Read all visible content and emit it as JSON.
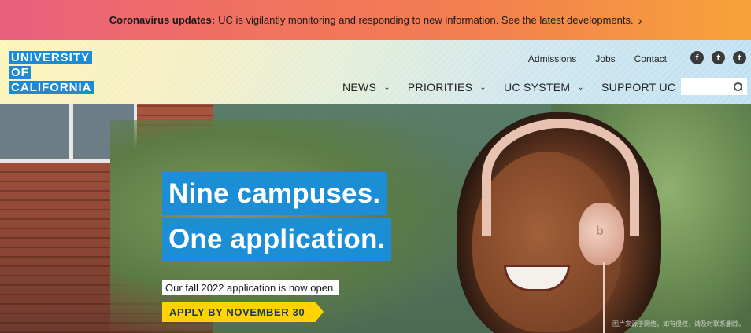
{
  "alert": {
    "label": "Coronavirus updates:",
    "message": "UC is vigilantly monitoring and responding to new information. See the latest developments.",
    "chevron": "›"
  },
  "logo": {
    "line1": "UNIVERSITY",
    "line2": "OF",
    "line3": "CALIFORNIA"
  },
  "utility_links": [
    "Admissions",
    "Jobs",
    "Contact"
  ],
  "social": [
    {
      "icon": "facebook-icon",
      "glyph": "f"
    },
    {
      "icon": "twitter-icon",
      "glyph": "t"
    },
    {
      "icon": "tumblr-icon",
      "glyph": "t"
    }
  ],
  "nav": {
    "items": [
      {
        "label": "NEWS"
      },
      {
        "label": "PRIORITIES"
      },
      {
        "label": "UC SYSTEM"
      },
      {
        "label": "SUPPORT UC"
      }
    ]
  },
  "search": {
    "placeholder": ""
  },
  "hero": {
    "headline1": "Nine campuses.",
    "headline2": "One application.",
    "subtext": "Our fall 2022 application is now open.",
    "cta": "APPLY BY NOVEMBER 30",
    "watermark": "图片来源于网络，如有侵权，请及时联系删除。"
  },
  "colors": {
    "accent_blue": "#1b8ed6",
    "cta_yellow": "#ffd200",
    "cta_text": "#1a3560"
  }
}
